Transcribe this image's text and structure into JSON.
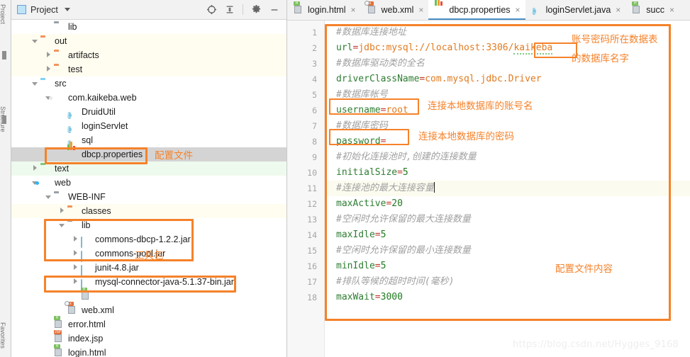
{
  "left_strip": {
    "labels": [
      "Project",
      "Structure",
      "Favorites"
    ]
  },
  "project_panel": {
    "title": "Project",
    "icons": [
      "project-window-icon",
      "locate-icon",
      "collapse-all-icon",
      "settings-gear-icon",
      "minimize-icon"
    ],
    "tree": [
      {
        "label": "lib",
        "icon": "folder-gray",
        "indent": 2,
        "arrow": "none",
        "hl": "none"
      },
      {
        "label": "out",
        "icon": "folder-orange",
        "indent": 1,
        "arrow": "down",
        "hl": "yellow"
      },
      {
        "label": "artifacts",
        "icon": "folder-orange",
        "indent": 2,
        "arrow": "right",
        "hl": "yellow"
      },
      {
        "label": "test",
        "icon": "folder-orange",
        "indent": 2,
        "arrow": "right",
        "hl": "yellow"
      },
      {
        "label": "src",
        "icon": "folder-blue",
        "indent": 1,
        "arrow": "down",
        "hl": "none"
      },
      {
        "label": "com.kaikeba.web",
        "icon": "package",
        "indent": 2,
        "arrow": "down",
        "hl": "none"
      },
      {
        "label": "DruidUtil",
        "icon": "java-class",
        "indent": 3,
        "arrow": "none",
        "hl": "none"
      },
      {
        "label": "loginServlet",
        "icon": "java-class",
        "indent": 3,
        "arrow": "none",
        "hl": "none"
      },
      {
        "label": "sql",
        "icon": "java-class",
        "indent": 3,
        "arrow": "none",
        "hl": "none"
      },
      {
        "label": "dbcp.properties",
        "icon": "properties",
        "indent": 3,
        "arrow": "none",
        "hl": "gray"
      },
      {
        "label": "text",
        "icon": "folder-green",
        "indent": 1,
        "arrow": "right",
        "hl": "green"
      },
      {
        "label": "web",
        "icon": "package-web",
        "indent": 1,
        "arrow": "down",
        "hl": "none"
      },
      {
        "label": "WEB-INF",
        "icon": "folder-gray",
        "indent": 2,
        "arrow": "down",
        "hl": "none"
      },
      {
        "label": "classes",
        "icon": "folder-orange",
        "indent": 3,
        "arrow": "right",
        "hl": "yellow"
      },
      {
        "label": "lib",
        "icon": "folder-gray",
        "indent": 3,
        "arrow": "down",
        "hl": "none"
      },
      {
        "label": "commons-dbcp-1.2.2.jar",
        "icon": "jar",
        "indent": 4,
        "arrow": "right",
        "hl": "none"
      },
      {
        "label": "commons-pool.jar",
        "icon": "jar",
        "indent": 4,
        "arrow": "right",
        "hl": "none"
      },
      {
        "label": "junit-4.8.jar",
        "icon": "jar",
        "indent": 4,
        "arrow": "right",
        "hl": "none"
      },
      {
        "label": "mysql-connector-java-5.1.37-bin.jar",
        "icon": "jar",
        "indent": 4,
        "arrow": "right",
        "hl": "none"
      },
      {
        "label": "",
        "icon": "file-html",
        "indent": 4,
        "arrow": "none",
        "hl": "none"
      },
      {
        "label": "web.xml",
        "icon": "file-xml",
        "indent": 3,
        "arrow": "none",
        "hl": "none"
      },
      {
        "label": "error.html",
        "icon": "file-html",
        "indent": 2,
        "arrow": "none",
        "hl": "none"
      },
      {
        "label": "index.jsp",
        "icon": "file-jsp",
        "indent": 2,
        "arrow": "none",
        "hl": "none"
      },
      {
        "label": "login.html",
        "icon": "file-html",
        "indent": 2,
        "arrow": "none",
        "hl": "none"
      }
    ]
  },
  "editor": {
    "tabs": [
      {
        "label": "login.html",
        "icon": "file-html",
        "active": false
      },
      {
        "label": "web.xml",
        "icon": "file-xml",
        "active": false
      },
      {
        "label": "dbcp.properties",
        "icon": "properties",
        "active": true
      },
      {
        "label": "loginServlet.java",
        "icon": "java-class",
        "active": false
      },
      {
        "label": "succ",
        "icon": "file-html",
        "active": false
      }
    ],
    "close_glyph": "×",
    "current_line": 11,
    "lines": [
      {
        "n": 1,
        "type": "comment",
        "text": "#数据库连接地址"
      },
      {
        "n": 2,
        "type": "prop",
        "key": "url",
        "value": "jdbc:mysql://localhost:3306/",
        "highlighted": "kaikeba"
      },
      {
        "n": 3,
        "type": "comment",
        "text": "#数据库驱动类的全名"
      },
      {
        "n": 4,
        "type": "prop",
        "key": "driverClassName",
        "value": "com.mysql.jdbc.Driver",
        "highlighted": ""
      },
      {
        "n": 5,
        "type": "comment",
        "text": "#数据库帐号"
      },
      {
        "n": 6,
        "type": "prop",
        "key": "username",
        "value": "root",
        "highlighted": ""
      },
      {
        "n": 7,
        "type": "comment",
        "text": "#数据库密码"
      },
      {
        "n": 8,
        "type": "prop",
        "key": "password",
        "value": "",
        "highlighted": ""
      },
      {
        "n": 9,
        "type": "comment",
        "text": "#初始化连接池时,创建的连接数量"
      },
      {
        "n": 10,
        "type": "prop",
        "key": "initialSize",
        "value": "5",
        "highlighted": ""
      },
      {
        "n": 11,
        "type": "comment",
        "text": "#连接池的最大连接容量"
      },
      {
        "n": 12,
        "type": "prop",
        "key": "maxActive",
        "value": "20",
        "highlighted": ""
      },
      {
        "n": 13,
        "type": "comment",
        "text": "#空闲时允许保留的最大连接数量"
      },
      {
        "n": 14,
        "type": "prop",
        "key": "maxIdle",
        "value": "5",
        "highlighted": ""
      },
      {
        "n": 15,
        "type": "comment",
        "text": "#空闲时允许保留的最小连接数量"
      },
      {
        "n": 16,
        "type": "prop",
        "key": "minIdle",
        "value": "5",
        "highlighted": ""
      },
      {
        "n": 17,
        "type": "comment",
        "text": "#排队等候的超时时间(毫秒)"
      },
      {
        "n": 18,
        "type": "prop",
        "key": "maxWait",
        "value": "3000",
        "highlighted": ""
      }
    ]
  },
  "annotations": {
    "accent_color": "#f5822a",
    "config_file": "配置文件",
    "toolkit": "工具包",
    "db_name_line1": "账号密码所在数据表",
    "db_name_line2": "的数据库名字",
    "username_note": "连接本地数据库的账号名",
    "password_note": "连接本地数据库的密码",
    "file_content": "配置文件内容"
  },
  "watermark": "https://blog.csdn.net/Hygges_9168"
}
